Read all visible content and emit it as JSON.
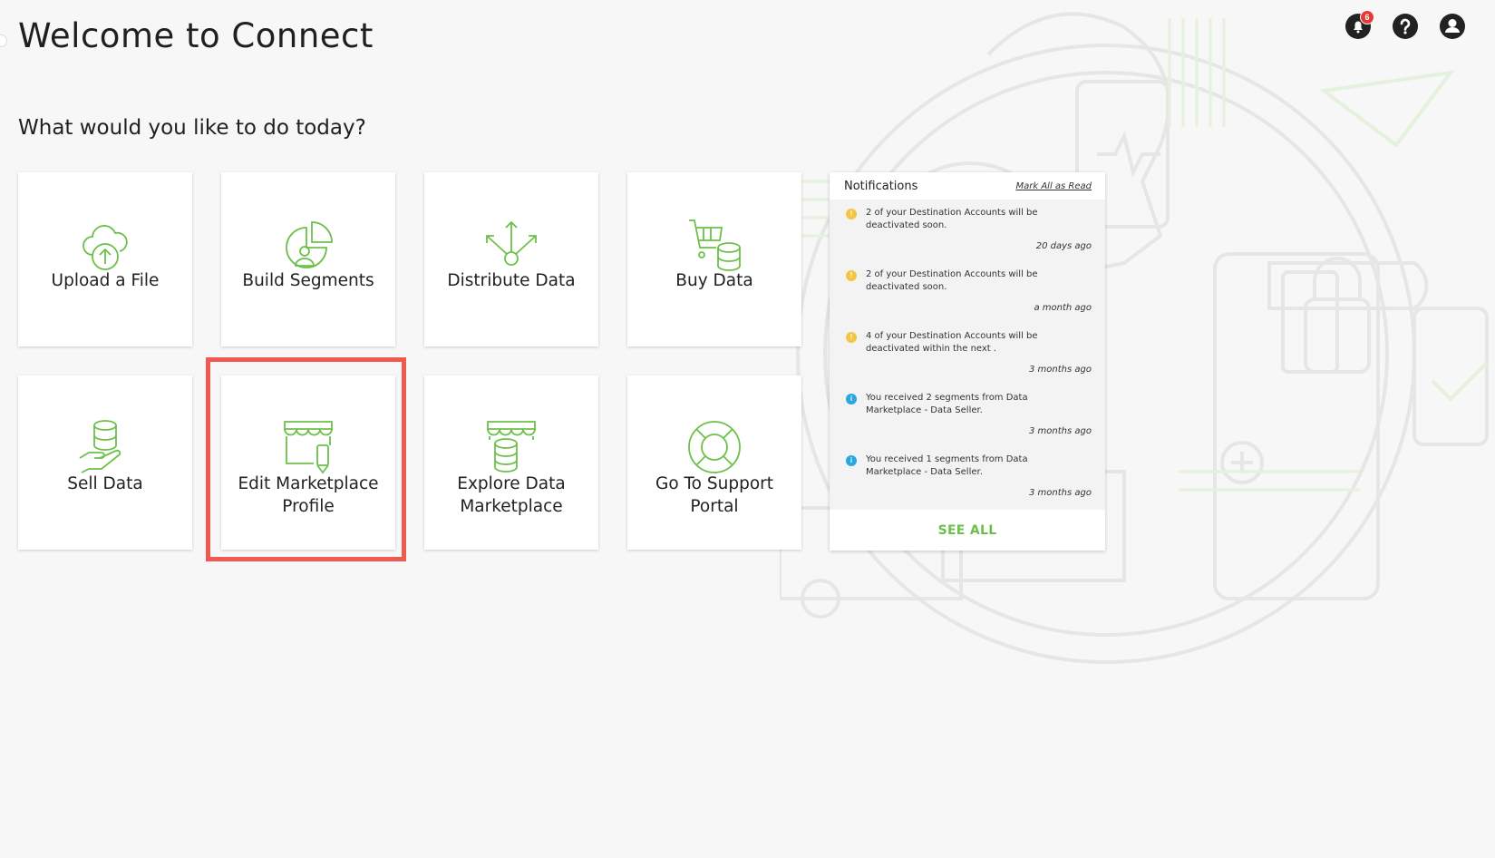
{
  "header": {
    "title": "Welcome to Connect",
    "notification_count": "6"
  },
  "main": {
    "subtitle": "What would you like to do today?",
    "tiles": [
      {
        "label": "Upload a File",
        "icon": "cloud-upload-icon"
      },
      {
        "label": "Build Segments",
        "icon": "segments-pie-icon"
      },
      {
        "label": "Distribute Data",
        "icon": "distribute-arrows-icon"
      },
      {
        "label": "Buy Data",
        "icon": "cart-database-icon"
      },
      {
        "label": "Sell Data",
        "icon": "hand-database-icon"
      },
      {
        "label": "Edit Marketplace Profile",
        "icon": "storefront-edit-icon"
      },
      {
        "label": "Explore Data Marketplace",
        "icon": "storefront-database-icon"
      },
      {
        "label": "Go To Support Portal",
        "icon": "lifebuoy-icon"
      }
    ]
  },
  "notifications": {
    "title": "Notifications",
    "mark_all": "Mark All as Read",
    "items": [
      {
        "type": "warning",
        "text": "2 of your Destination Accounts will be deactivated soon.",
        "time": "20 days ago"
      },
      {
        "type": "warning",
        "text": "2 of your Destination Accounts will be deactivated soon.",
        "time": "a month ago"
      },
      {
        "type": "warning",
        "text": "4 of your Destination Accounts will be deactivated within the next .",
        "time": "3 months ago"
      },
      {
        "type": "info",
        "text": "You received 2 segments from Data Marketplace - Data Seller.",
        "time": "3 months ago"
      },
      {
        "type": "info",
        "text": "You received 1 segments from Data Marketplace - Data Seller.",
        "time": "3 months ago"
      }
    ],
    "see_all": "SEE ALL"
  },
  "colors": {
    "accent_green": "#6cc04a",
    "highlight_red": "#ee5a4f",
    "warning": "#f4c542",
    "info": "#2aa6e0",
    "badge": "#e53935"
  }
}
